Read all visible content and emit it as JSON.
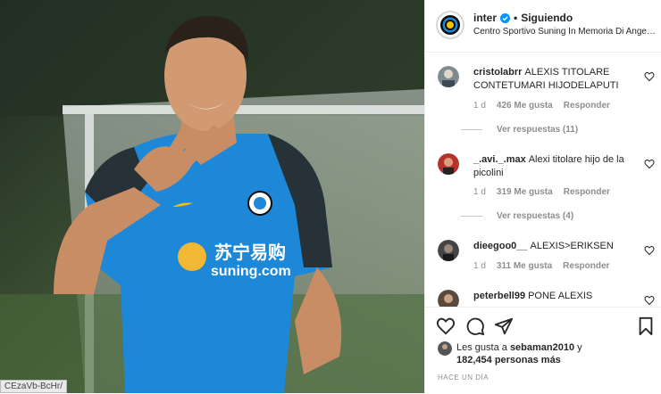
{
  "post": {
    "username": "inter",
    "follow_status": "Siguiendo",
    "location": "Centro Sportivo Suning In Memoria Di Angelo Moratti",
    "image_url_tag": "CEzaVb-BcHr/",
    "photo_print": {
      "sponsor_cn": "苏宁易购",
      "sponsor_en": "suning.com"
    }
  },
  "comments": [
    {
      "username": "cristolabrr",
      "text": "ALEXIS TITOLARE CONTETUMARI HIJODELAPUTI",
      "time": "1 d",
      "likes": "426 Me gusta",
      "reply": "Responder",
      "view_replies": "Ver respuestas (11)"
    },
    {
      "username": "_.avi._.max",
      "text": "Alexi titolare hijo de la picolini",
      "time": "1 d",
      "likes": "319 Me gusta",
      "reply": "Responder",
      "view_replies": "Ver respuestas (4)"
    },
    {
      "username": "dieegoo0__",
      "text": "ALEXIS>ERIKSEN",
      "time": "1 d",
      "likes": "311 Me gusta",
      "reply": "Responder"
    },
    {
      "username": "peterbell99",
      "text": "PONE ALEXIS"
    }
  ],
  "likes": {
    "prefix": "Les gusta a",
    "user": "sebaman2010",
    "joiner": "y",
    "count": "182,454 personas más"
  },
  "time_ago": "HACE UN DÍA",
  "icons": [
    "verified-icon",
    "heart-icon",
    "comment-icon",
    "share-icon",
    "save-icon"
  ],
  "colors": {
    "accent": "#0095f6",
    "jersey": "#1e88d8",
    "muted": "#8e8e8e"
  }
}
